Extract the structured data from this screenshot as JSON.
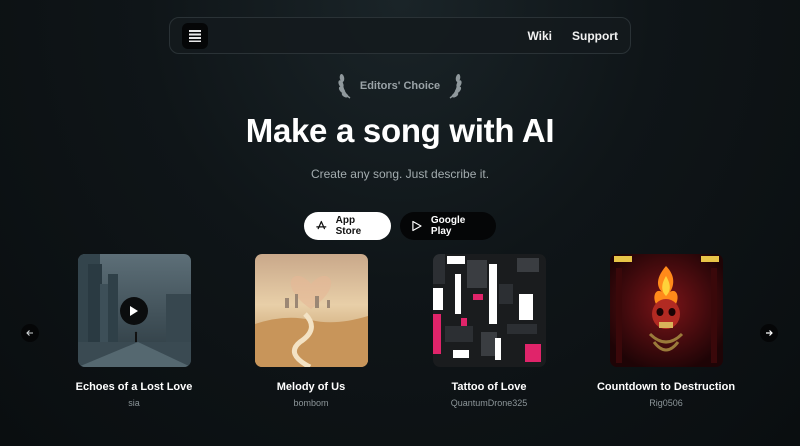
{
  "nav": {
    "logo_icon": "waveform-logo-icon",
    "links": [
      {
        "label": "Wiki"
      },
      {
        "label": "Support"
      }
    ]
  },
  "hero": {
    "badge": "Editors' Choice",
    "title": "Make a song with AI",
    "subtitle": "Create any song. Just describe it."
  },
  "stores": [
    {
      "label": "App Store",
      "icon": "app-store-icon",
      "style": "light"
    },
    {
      "label": "Google Play",
      "icon": "google-play-icon",
      "style": "dark"
    }
  ],
  "songs": [
    {
      "title": "Echoes of a Lost Love",
      "artist": "sia",
      "playing_icon": "play-icon"
    },
    {
      "title": "Melody of Us",
      "artist": "bombom"
    },
    {
      "title": "Tattoo of Love",
      "artist": "QuantumDrone325"
    },
    {
      "title": "Countdown to Destruction",
      "artist": "Rig0506"
    }
  ],
  "carousel": {
    "prev_icon": "arrow-left-icon",
    "next_icon": "arrow-right-icon"
  },
  "colors": {
    "accent": "#ffffff",
    "background": "#0f1518",
    "muted_text": "#8c9599",
    "tattoo_pink": "#e0246a",
    "skull_fire": "#ff8a1a"
  }
}
